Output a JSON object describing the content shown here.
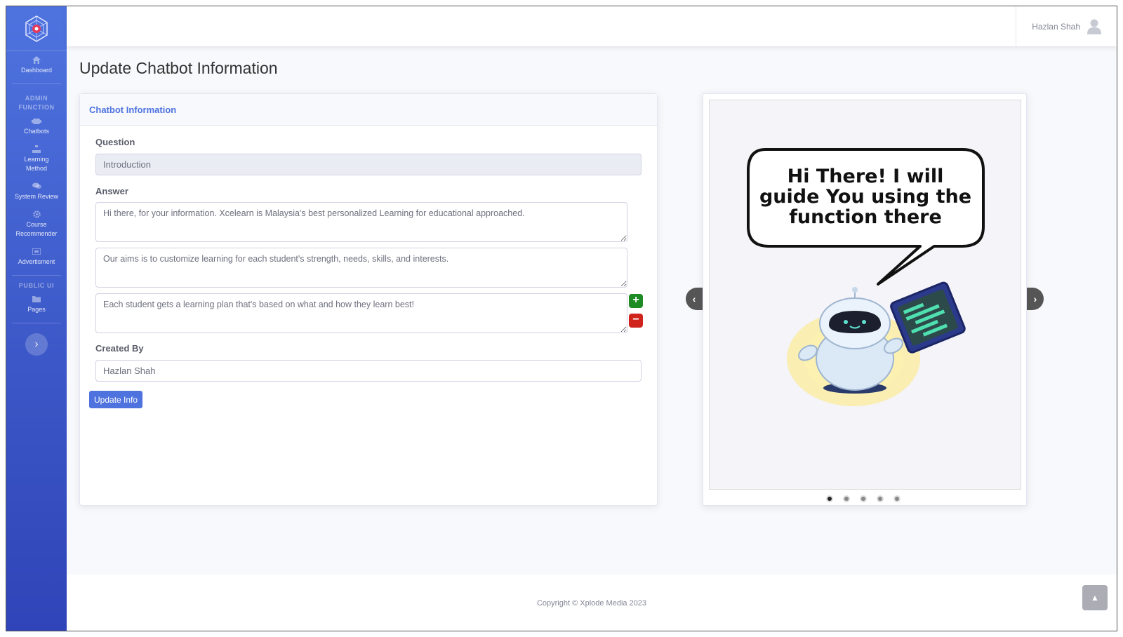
{
  "sidebar": {
    "items_top": [
      {
        "label": "Dashboard",
        "icon": "home-icon"
      }
    ],
    "heading_admin": "ADMIN FUNCTION",
    "items_admin": [
      {
        "label": "Chatbots",
        "icon": "robot-icon"
      },
      {
        "label": "Learning Method",
        "icon": "sitemap-icon"
      },
      {
        "label": "System Review",
        "icon": "comments-icon"
      },
      {
        "label": "Course Recommender",
        "icon": "gear-icon"
      },
      {
        "label": "Advertisment",
        "icon": "ad-icon"
      }
    ],
    "heading_public": "PUBLIC UI",
    "items_public": [
      {
        "label": "Pages",
        "icon": "folder-icon"
      }
    ]
  },
  "topbar": {
    "user_name": "Hazlan Shah"
  },
  "page": {
    "title": "Update Chatbot Information"
  },
  "form": {
    "header": "Chatbot Information",
    "question_label": "Question",
    "question_value": "Introduction",
    "answer_label": "Answer",
    "answers": [
      "Hi there, for your information. Xcelearn is Malaysia's best personalized Learning for educational approached.",
      "Our aims is to customize learning for each student's strength, needs, skills, and interests.",
      "Each student gets a learning plan that's based on what and how they learn best!"
    ],
    "created_by_label": "Created By",
    "created_by_value": "Hazlan Shah",
    "submit_label": "Update Info",
    "add_symbol": "+",
    "remove_symbol": "−"
  },
  "carousel": {
    "bubble_text": [
      "Hi There! I will",
      "guide You using the",
      "function there"
    ],
    "slide_count": 5,
    "active_index": 0
  },
  "footer": {
    "copyright": "Copyright © Xplode Media 2023"
  },
  "colors": {
    "primary": "#4e73df",
    "success": "#1f8b24",
    "danger": "#d0231b"
  }
}
